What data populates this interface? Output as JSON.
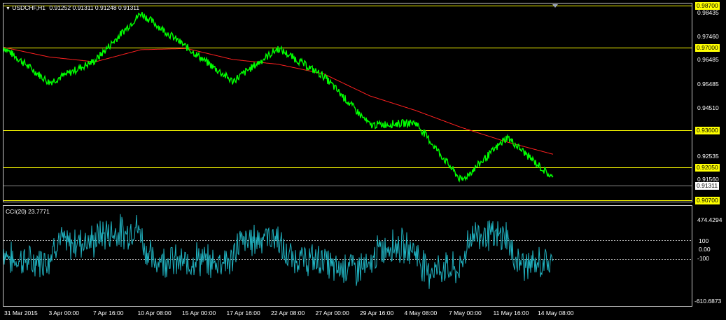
{
  "header": {
    "menu_glyph": "▼",
    "symbol": "USDCHF,H1",
    "ohlc": "0.91252 0.91311 0.91248 0.91311"
  },
  "indicator": {
    "label": "CCI(20) 23.7771",
    "max": "474.4294",
    "min": "-610.6873",
    "levels": [
      "100",
      "0.00",
      "-100"
    ]
  },
  "price_axis": {
    "ticks": [
      "0.98435",
      "0.97460",
      "0.96485",
      "0.95485",
      "0.94510",
      "0.92535",
      "0.91560"
    ]
  },
  "hlines": [
    {
      "label": "0.98700",
      "kind": "yellow"
    },
    {
      "label": "0.97000",
      "kind": "yellow"
    },
    {
      "label": "0.93600",
      "kind": "yellow"
    },
    {
      "label": "0.92050",
      "kind": "yellow"
    },
    {
      "label": "0.91311",
      "kind": "current"
    },
    {
      "label": "0.90700",
      "kind": "yellow"
    }
  ],
  "time_axis": [
    "31 Mar 2015",
    "3 Apr 00:00",
    "7 Apr 16:00",
    "10 Apr 08:00",
    "15 Apr 00:00",
    "17 Apr 16:00",
    "22 Apr 08:00",
    "27 Apr 00:00",
    "29 Apr 16:00",
    "4 May 08:00",
    "7 May 00:00",
    "11 May 16:00",
    "14 May 08:00"
  ],
  "colors": {
    "price": "#00ff00",
    "ma": "#ff2020",
    "cci": "#20b2c0",
    "level_line": "#ffff00",
    "background": "#000000"
  },
  "chart_data": {
    "type": "line",
    "price_series": {
      "x": [
        "31 Mar 2015",
        "3 Apr 00:00",
        "7 Apr 16:00",
        "10 Apr 08:00",
        "15 Apr 00:00",
        "17 Apr 16:00",
        "22 Apr 08:00",
        "27 Apr 00:00",
        "29 Apr 16:00",
        "4 May 08:00",
        "7 May 00:00",
        "11 May 16:00",
        "14 May 08:00"
      ],
      "close": [
        0.97,
        0.9555,
        0.9645,
        0.984,
        0.97,
        0.956,
        0.9695,
        0.958,
        0.938,
        0.939,
        0.915,
        0.933,
        0.916
      ],
      "ma": [
        0.97,
        0.966,
        0.964,
        0.969,
        0.9695,
        0.965,
        0.963,
        0.959,
        0.95,
        0.944,
        0.937,
        0.931,
        0.926
      ]
    },
    "last_price": 0.91311,
    "cci": {
      "last": 23.7771,
      "max": 474.4294,
      "min": -610.6873,
      "levels": [
        100,
        0,
        -100
      ]
    }
  }
}
